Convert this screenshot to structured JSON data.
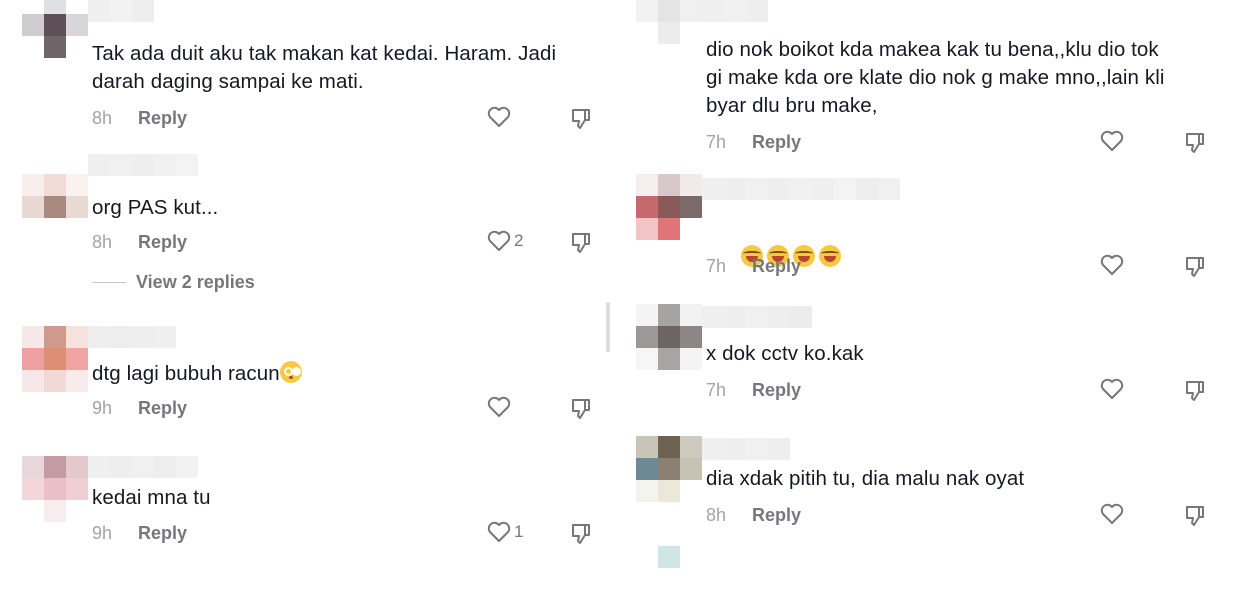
{
  "left_comments": [
    {
      "text": "Tak ada duit aku tak makan kat kedai. Haram. Jadi\ndarah daging sampai ke mati.",
      "time": "8h",
      "reply": "Reply",
      "likes": ""
    },
    {
      "text": "org PAS kut...",
      "time": "8h",
      "reply": "Reply",
      "likes": "2",
      "view_replies": "View 2 replies"
    },
    {
      "text": "dtg lagi bubuh racun",
      "emoji": "flushed-face",
      "time": "9h",
      "reply": "Reply",
      "likes": ""
    },
    {
      "text": "kedai mna tu",
      "time": "9h",
      "reply": "Reply",
      "likes": "1"
    }
  ],
  "right_comments": [
    {
      "text": "dio nok boikot kda makea kak tu bena,,klu dio tok\ngi make kda ore klate dio nok g make mno,,lain kli\nbyar dlu bru make,",
      "time": "7h",
      "reply": "Reply",
      "likes": ""
    },
    {
      "text": "",
      "emoji": "laughing-tears x4",
      "time": "7h",
      "reply": "Reply",
      "likes": ""
    },
    {
      "text": "x dok cctv ko.kak",
      "time": "7h",
      "reply": "Reply",
      "likes": ""
    },
    {
      "text": "dia xdak pitih tu, dia malu nak oyat",
      "time": "8h",
      "reply": "Reply",
      "likes": ""
    }
  ],
  "icons": {
    "like": "heart-outline-icon",
    "dislike": "thumbs-down-icon"
  },
  "colors": {
    "text": "#161823",
    "meta": "#a2a3a8",
    "reply": "#76777d"
  }
}
